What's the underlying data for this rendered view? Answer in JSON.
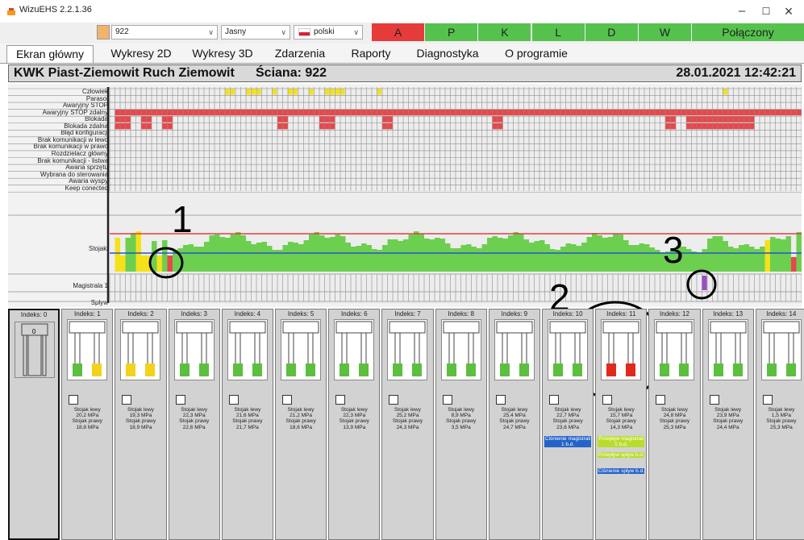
{
  "window": {
    "title": "WizuEHS 2.2.1.36",
    "minimize": "–",
    "maximize": "☐",
    "close": "×"
  },
  "toolbar": {
    "wall_select": "922",
    "theme_select": "Jasny",
    "language_select": "polski",
    "status_cells": [
      {
        "label": "A",
        "color": "#e63b3b"
      },
      {
        "label": "P",
        "color": "#55c24e"
      },
      {
        "label": "K",
        "color": "#55c24e"
      },
      {
        "label": "L",
        "color": "#55c24e"
      },
      {
        "label": "D",
        "color": "#55c24e"
      },
      {
        "label": "W",
        "color": "#55c24e"
      }
    ],
    "connection": "Połączony",
    "connection_color": "#55c24e"
  },
  "tabs": [
    "Ekran główny",
    "Wykresy 2D",
    "Wykresy 3D",
    "Zdarzenia",
    "Raporty",
    "Diagnostyka",
    "O programie"
  ],
  "header": {
    "mine": "KWK Piast-Ziemowit Ruch Ziemowit",
    "wall": "Ściana: 922",
    "datetime": "28.01.2021 12:42:21"
  },
  "status_rows": [
    "Człowiek",
    "Parasol",
    "Awaryjny STOP",
    "Awaryjny STOP zdalny",
    "Blokada",
    "Blokada zdalna",
    "Błąd konfiguracji",
    "Brak komunikacji w lewo",
    "Brak komunikacji w prawo",
    "Rozdzielacz główny",
    "Brak komunikacji - listwa",
    "Awaria sprzętu",
    "Wybrana do sterowania",
    "Awaria wyspy",
    "Keep conected"
  ],
  "section_rows": {
    "stojaki": "Stojaki",
    "magistrala": "Magistrala 1",
    "splyw": "Spływ"
  },
  "annotations": [
    "1",
    "2",
    "3"
  ],
  "cards": [
    {
      "index": "Indeks: 0",
      "number": "0"
    },
    {
      "index": "Indeks: 1",
      "left": "Stojak lewy",
      "left_val": "20,2 MPa",
      "right": "Stojak prawy",
      "right_val": "18,8 MPa",
      "colors": [
        "#5cbf3e",
        "#f2d21d"
      ]
    },
    {
      "index": "Indeks: 2",
      "left": "Stojak lewy",
      "left_val": "19,3 MPa",
      "right": "Stojak prawy",
      "right_val": "18,9 MPa",
      "colors": [
        "#f2d21d",
        "#f2d21d"
      ]
    },
    {
      "index": "Indeks: 3",
      "left": "Stojak lewy",
      "left_val": "22,3 MPa",
      "right": "Stojak prawy",
      "right_val": "22,6 MPa",
      "colors": [
        "#5cbf3e",
        "#5cbf3e"
      ]
    },
    {
      "index": "Indeks: 4",
      "left": "Stojak lewy",
      "left_val": "21,6 MPa",
      "right": "Stojak prawy",
      "right_val": "21,7 MPa",
      "colors": [
        "#5cbf3e",
        "#5cbf3e"
      ]
    },
    {
      "index": "Indeks: 5",
      "left": "Stojak lewy",
      "left_val": "21,2 MPa",
      "right": "Stojak prawy",
      "right_val": "18,6 MPa",
      "colors": [
        "#5cbf3e",
        "#5cbf3e"
      ]
    },
    {
      "index": "Indeks: 6",
      "left": "Stojak lewy",
      "left_val": "22,3 MPa",
      "right": "Stojak prawy",
      "right_val": "13,9 MPa",
      "colors": [
        "#5cbf3e",
        "#5cbf3e"
      ]
    },
    {
      "index": "Indeks: 7",
      "left": "Stojak lewy",
      "left_val": "25,2 MPa",
      "right": "Stojak prawy",
      "right_val": "24,3 MPa",
      "colors": [
        "#5cbf3e",
        "#5cbf3e"
      ]
    },
    {
      "index": "Indeks: 8",
      "left": "Stojak lewy",
      "left_val": "8,9 MPa",
      "right": "Stojak prawy",
      "right_val": "3,5 MPa",
      "colors": [
        "#5cbf3e",
        "#5cbf3e"
      ]
    },
    {
      "index": "Indeks: 9",
      "left": "Stojak lewy",
      "left_val": "25,4 MPa",
      "right": "Stojak prawy",
      "right_val": "24,7 MPa",
      "colors": [
        "#5cbf3e",
        "#5cbf3e"
      ]
    },
    {
      "index": "Indeks: 10",
      "left": "Stojak lewy",
      "left_val": "22,7 MPa",
      "right": "Stojak prawy",
      "right_val": "23,6 MPa",
      "colors": [
        "#5cbf3e",
        "#5cbf3e"
      ],
      "alarms": [
        {
          "text": "Ciśnienie magistrali 1 b.d.",
          "color": "#2563c9"
        }
      ]
    },
    {
      "index": "Indeks: 11",
      "left": "Stojak lewy",
      "left_val": "15,7 MPa",
      "right": "Stojak prawy",
      "right_val": "14,3 MPa",
      "colors": [
        "#e02a1c",
        "#e02a1c"
      ],
      "alarms": [
        {
          "text": "Przepływ magistrali 1 b.d.",
          "color": "#b9dc2c"
        },
        {
          "text": "Przepływ spływ b.d.",
          "color": "#b9dc2c"
        },
        {
          "text": "Ciśnienie spływ b.d.",
          "color": "#2563c9"
        }
      ]
    },
    {
      "index": "Indeks: 12",
      "left": "Stojak lewy",
      "left_val": "24,8 MPa",
      "right": "Stojak prawy",
      "right_val": "25,3 MPa",
      "colors": [
        "#5cbf3e",
        "#5cbf3e"
      ]
    },
    {
      "index": "Indeks: 13",
      "left": "Stojak lewy",
      "left_val": "23,9 MPa",
      "right": "Stojak prawy",
      "right_val": "24,4 MPa",
      "colors": [
        "#5cbf3e",
        "#5cbf3e"
      ]
    },
    {
      "index": "Indeks: 14",
      "left": "Stojak lewy",
      "left_val": "1,5 MPa",
      "right": "Stojak prawy",
      "right_val": "25,3 MPa",
      "colors": [
        "#5cbf3e",
        "#5cbf3e"
      ]
    }
  ],
  "colors": {
    "alarm_red": "#e8474b",
    "event_yellow": "#f5e11a",
    "stojak_green": "#6dcf4f",
    "limit_red": "#e04040",
    "limit_blue": "#2256c8",
    "magistrala_purple": "#9b4fc4"
  }
}
